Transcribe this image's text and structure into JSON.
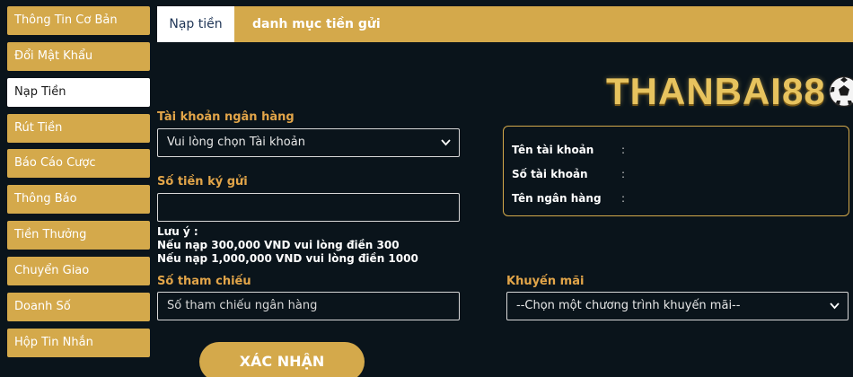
{
  "sidebar": {
    "items": [
      {
        "label": "Thông Tin Cơ Bản"
      },
      {
        "label": "Đổi Mật Khẩu"
      },
      {
        "label": "Nạp Tiền"
      },
      {
        "label": "Rút Tiền"
      },
      {
        "label": "Báo Cáo Cược"
      },
      {
        "label": "Thông Báo"
      },
      {
        "label": "Tiền Thưởng"
      },
      {
        "label": "Chuyển Giao"
      },
      {
        "label": "Doanh Số"
      },
      {
        "label": "Hộp Tin Nhắn"
      }
    ],
    "active_index": 2
  },
  "tabs": {
    "deposit": "Nạp tiền",
    "category": "danh mục tiền gửi"
  },
  "logo": {
    "text": "THANBAI88"
  },
  "form": {
    "bank_account_label": "Tài khoản ngân hàng",
    "bank_account_value": "Vui lòng chọn Tài khoản",
    "amount_label": "Số tiền ký gửi",
    "amount_value": "",
    "note_title": "Lưu ý :",
    "note_line1": "Nếu nạp 300,000 VND vui lòng điền 300",
    "note_line2": "Nếu nạp 1,000,000 VND vui lòng điền 1000",
    "reference_label": "Số tham chiếu",
    "reference_placeholder": "Số tham chiếu ngân hàng",
    "promo_label": "Khuyến mãi",
    "promo_value": "--Chọn một chương trình khuyến mãi--",
    "submit_label": "XÁC NHẬN"
  },
  "account_info": {
    "account_name_label": "Tên tài khoản",
    "account_number_label": "Số tài khoản",
    "bank_name_label": "Tên ngân hàng",
    "separator": ":"
  },
  "colors": {
    "accent": "#d4a94b",
    "label": "#e2a549",
    "background": "#0a141b"
  }
}
